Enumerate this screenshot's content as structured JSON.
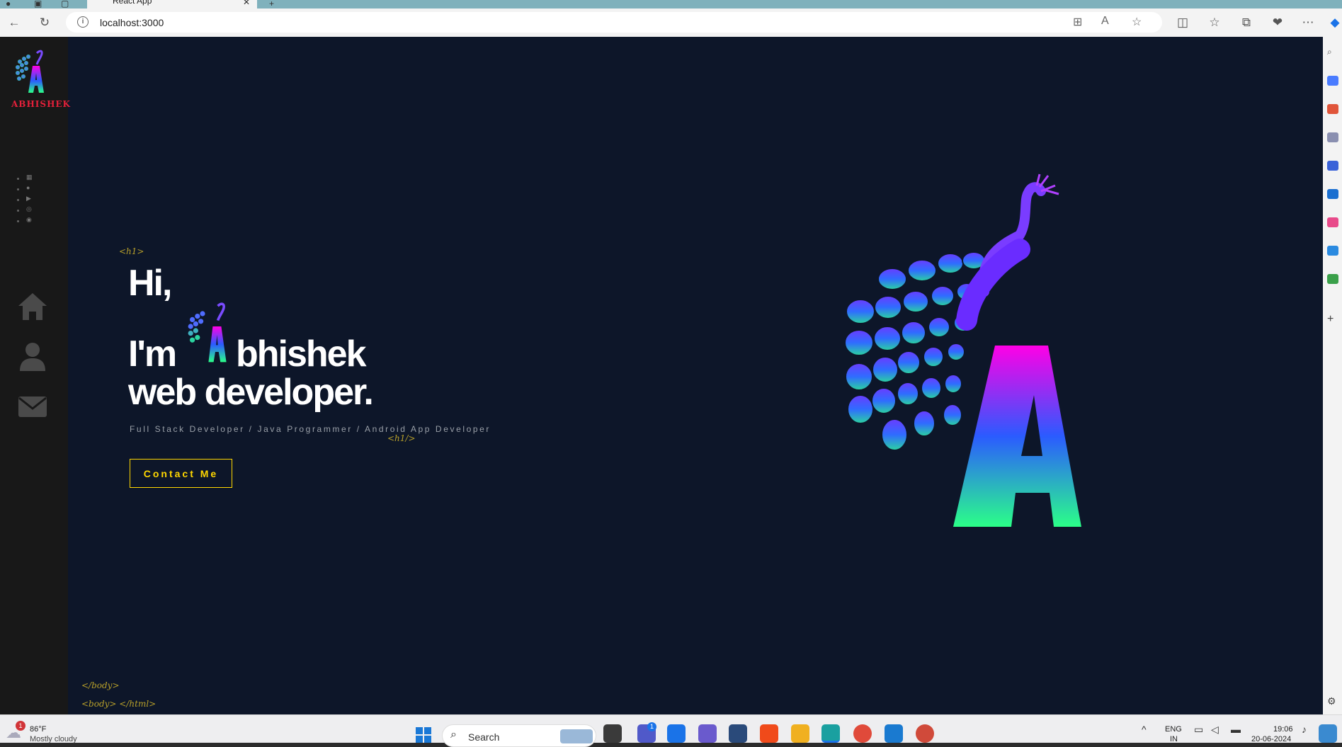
{
  "browser": {
    "tab_title": "React App",
    "url": "localhost:3000"
  },
  "site": {
    "logo_text": "ABHISHEK",
    "tags": {
      "h1_open": "<h1>",
      "h1_close": "<h1/>",
      "body_close": "</body>",
      "html_close": "<body> </html>"
    },
    "hero": {
      "line1": "Hi,",
      "line2_prefix": "I'm",
      "line2_rest": "bhishek",
      "line3": "web developer."
    },
    "subtitle": "Full Stack Developer / Java Programmer / Android App Developer",
    "contact_button": "Contact Me",
    "social_icons": [
      "linkedin-icon",
      "github-icon",
      "youtube-icon",
      "instagram-icon",
      "discord-icon"
    ],
    "nav_icons": [
      "home-icon",
      "user-icon",
      "mail-icon"
    ]
  },
  "taskbar": {
    "weather_temp": "86°F",
    "weather_desc": "Mostly cloudy",
    "weather_badge": "1",
    "search_placeholder": "Search",
    "teams_badge": "1",
    "lang_top": "ENG",
    "lang_bottom": "IN",
    "time": "19:06",
    "date": "20-06-2024"
  },
  "colors": {
    "page_bg": "#0d1629",
    "sidebar_bg": "#181818",
    "accent_yellow": "#ffd700",
    "tag_color": "#b8a02a",
    "logo_red": "#e4203a"
  }
}
